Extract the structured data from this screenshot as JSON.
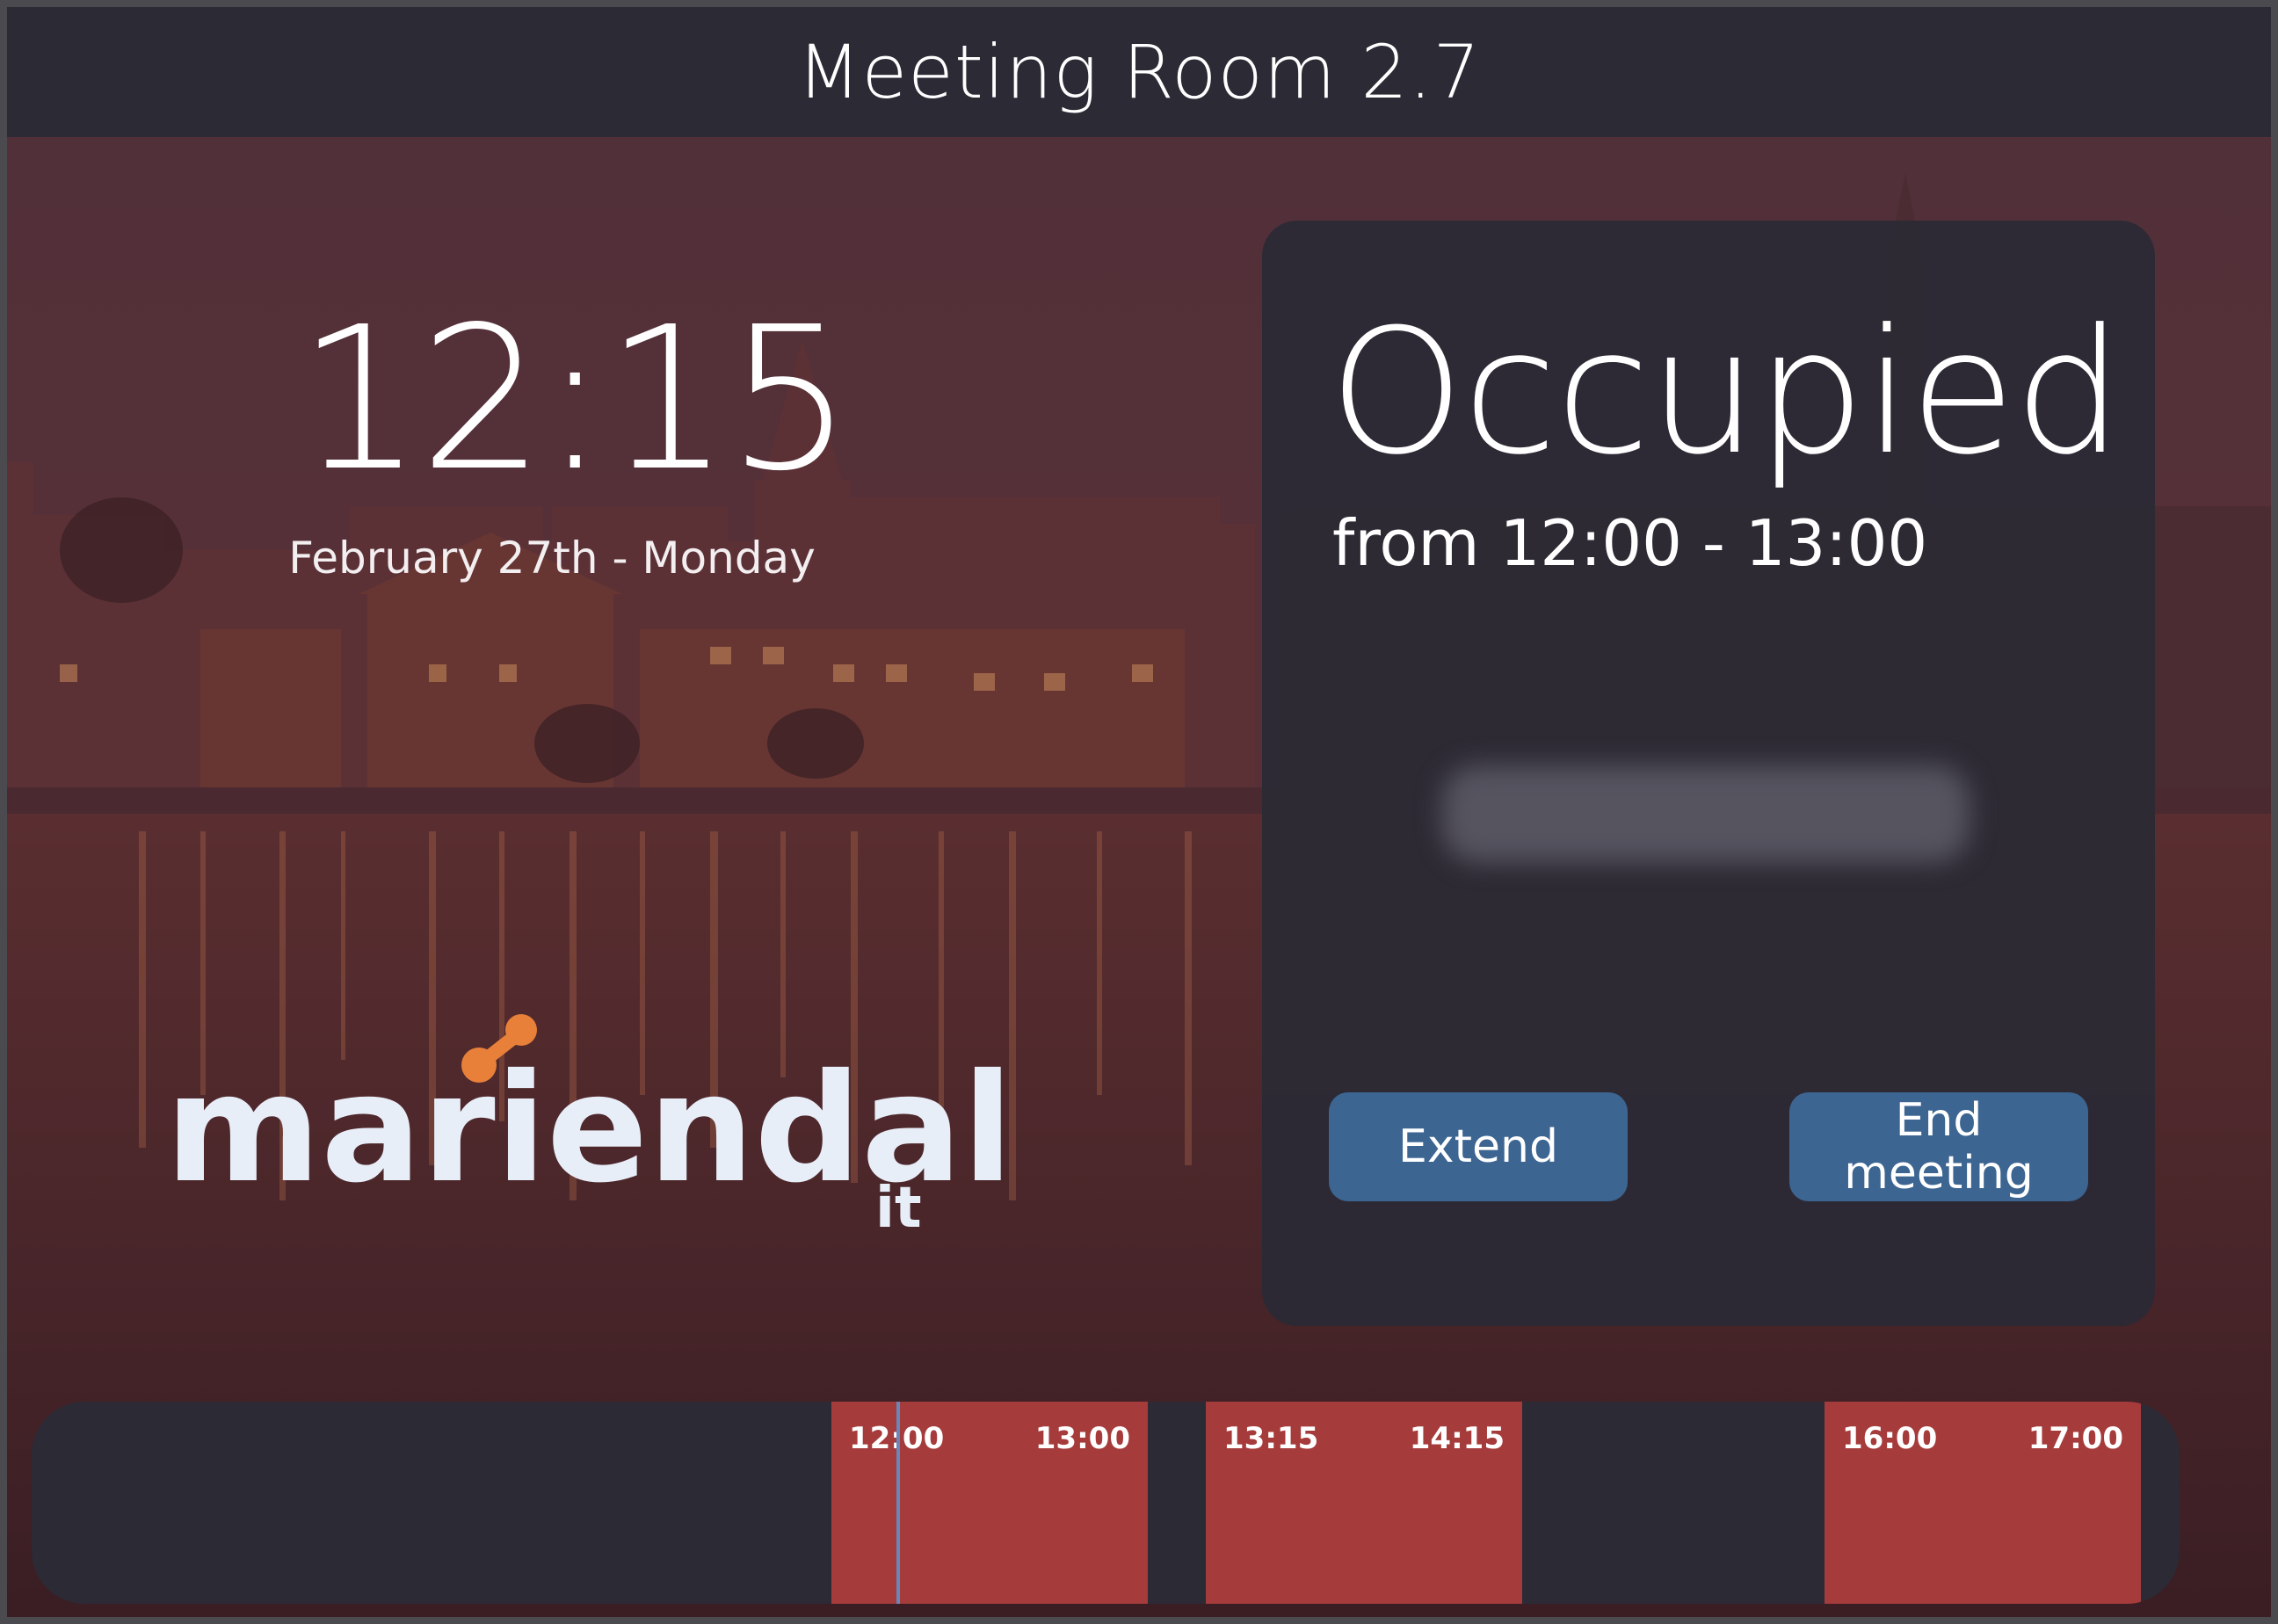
{
  "room": {
    "title": "Meeting Room 2.7"
  },
  "clock": {
    "time": "12:15",
    "date": "February 27th - Monday"
  },
  "logo": {
    "word": "mariendal",
    "sub": "it",
    "accent_color": "#e8803a"
  },
  "status": {
    "label": "Occupied",
    "range": "from 12:00 - 13:00",
    "organizer_blurred": true
  },
  "actions": {
    "extend_label": "Extend",
    "end_label": "End meeting"
  },
  "timeline": {
    "bookings": [
      {
        "start": "12:00",
        "end": "13:00"
      },
      {
        "start": "13:15",
        "end": "14:15"
      },
      {
        "start": "16:00",
        "end": "17:00"
      }
    ],
    "now": "12:15"
  },
  "colors": {
    "panel": "#2b2a35",
    "button": "#3c6591",
    "booking": "#a63b3b",
    "now_marker": "#6b86b8"
  }
}
